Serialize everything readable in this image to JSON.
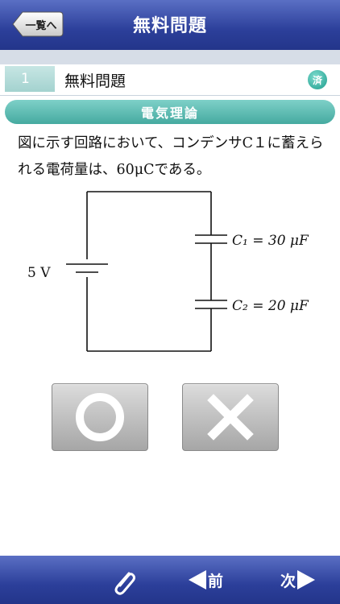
{
  "header": {
    "title": "無料問題",
    "back_label": "一覧へ"
  },
  "question_row": {
    "number": "1",
    "label": "無料問題",
    "badge": "済"
  },
  "category": "電気理論",
  "question_text": "図に示す回路において、コンデンサC１に蓄えられる電荷量は、60μCである。",
  "circuit": {
    "voltage_label": "5 V",
    "c1_label": "C₁ = 30 μF",
    "c2_label": "C₂ = 20 μF"
  },
  "answers": {
    "true_icon": "circle-icon",
    "false_icon": "cross-icon"
  },
  "footer": {
    "prev_label": "前",
    "next_label": "次",
    "clip_icon": "paperclip-icon"
  }
}
